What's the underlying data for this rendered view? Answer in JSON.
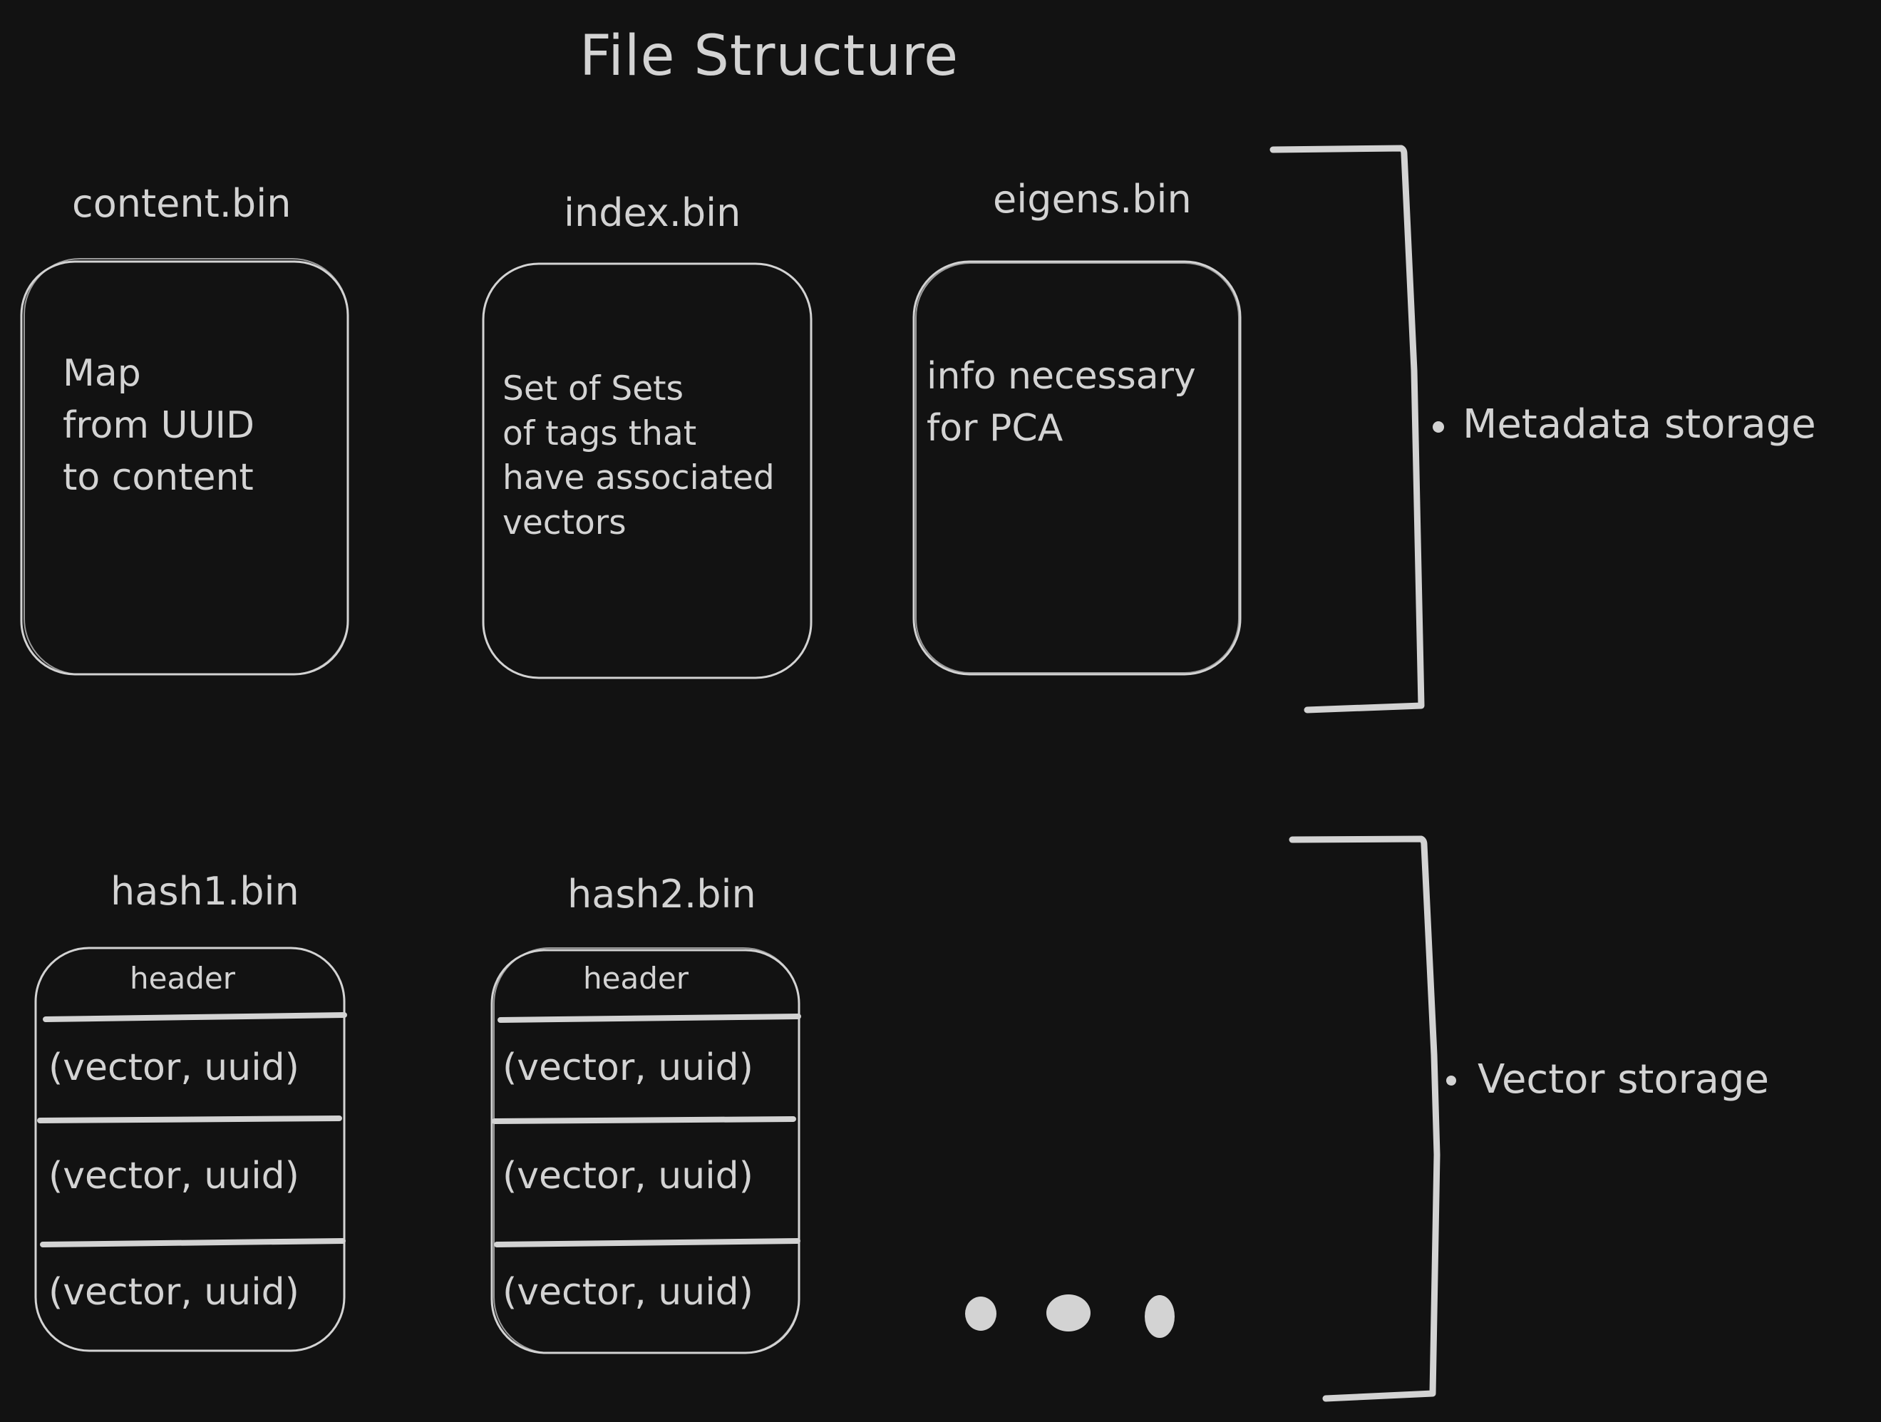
{
  "title": "File Structure",
  "groups": {
    "metadata": {
      "label": "Metadata storage",
      "files": [
        {
          "name": "content.bin",
          "description": "Map\nfrom UUID\nto content"
        },
        {
          "name": "index.bin",
          "description": "Set of Sets\nof tags that\nhave associated\nvectors"
        },
        {
          "name": "eigens.bin",
          "description": "info necessary\nfor PCA"
        }
      ]
    },
    "vector": {
      "label": "Vector storage",
      "files": [
        {
          "name": "hash1.bin",
          "header": "header",
          "rows": [
            "(vector, uuid)",
            "(vector, uuid)",
            "(vector, uuid)"
          ]
        },
        {
          "name": "hash2.bin",
          "header": "header",
          "rows": [
            "(vector, uuid)",
            "(vector, uuid)",
            "(vector, uuid)"
          ]
        }
      ],
      "continuation": "..."
    }
  },
  "colors": {
    "background": "#121212",
    "stroke": "#d3d3d3"
  }
}
